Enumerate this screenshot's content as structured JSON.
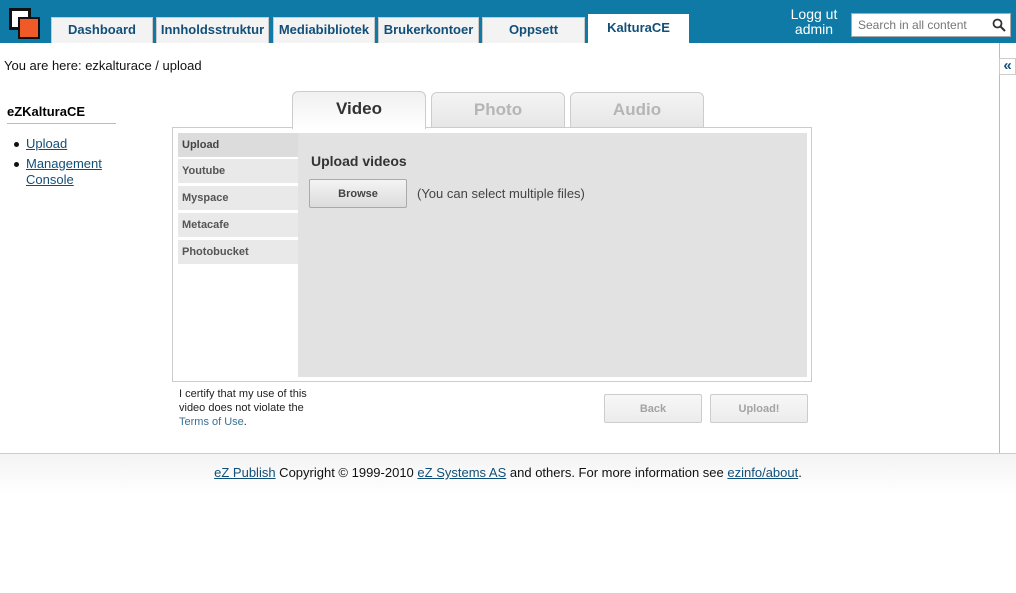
{
  "header": {
    "tabs": [
      {
        "label": "Dashboard"
      },
      {
        "label": "Innholdsstruktur"
      },
      {
        "label": "Mediabibliotek"
      },
      {
        "label": "Brukerkontoer"
      },
      {
        "label": "Oppsett"
      },
      {
        "label": "KalturaCE",
        "active": true
      }
    ],
    "logout_label": "Logg ut",
    "username": "admin",
    "search_placeholder": "Search in all content",
    "accent_color": "#0f7aa6"
  },
  "breadcrumb": "You are here: ezkalturace / upload",
  "collapse_label": "«",
  "sidebar": {
    "title": "eZKalturaCE",
    "items": [
      {
        "label": "Upload"
      },
      {
        "label": "Management Console"
      }
    ]
  },
  "media_tabs": [
    {
      "label": "Video",
      "active": true
    },
    {
      "label": "Photo"
    },
    {
      "label": "Audio"
    }
  ],
  "side_menu": [
    {
      "label": "Upload",
      "active": true
    },
    {
      "label": "Youtube"
    },
    {
      "label": "Myspace"
    },
    {
      "label": "Metacafe"
    },
    {
      "label": "Photobucket"
    }
  ],
  "upload": {
    "heading": "Upload videos",
    "browse_label": "Browse",
    "note": "(You can select multiple files)"
  },
  "certify": {
    "text": "I certify that my use of this video does not violate the",
    "link": "Terms of Use",
    "end": "."
  },
  "actions": {
    "back_label": "Back",
    "upload_label": "Upload!"
  },
  "footer": {
    "ez_publish": "eZ Publish",
    "copyright": " Copyright © 1999-2010 ",
    "ez_systems": "eZ Systems AS",
    "more_info": " and others. For more information see ",
    "ezinfo": "ezinfo/about",
    "end": "."
  }
}
